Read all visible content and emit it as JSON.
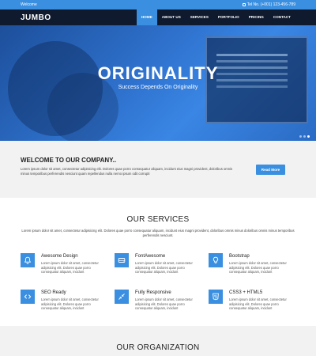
{
  "topbar": {
    "welcome": "Welcome",
    "phone": "Tel No. (+001) 123-456-789"
  },
  "logo": "JUMBO",
  "nav": [
    "HOME",
    "ABOUT US",
    "SERVICES",
    "PORTFOLIO",
    "PRICING",
    "CONTACT"
  ],
  "nav_active": "HOME",
  "hero": {
    "title": "ORIGINALITY",
    "subtitle": "Success Depends On Originality",
    "slide_count": 3,
    "active_slide": 3
  },
  "welcome": {
    "title": "WELCOME TO OUR COMPANY..",
    "text": "Lorem ipsum dolor sit amet, consectetur adipisicing elit. Dolores quae porro consequatur aliquam, incidunt eius magni provident, doloribus omnis minus temporibus perferendis nesciunt quam repellendus nulla nemo ipsum odit corrupti",
    "button": "Read More"
  },
  "services": {
    "title": "OUR SERVICES",
    "desc": "Lorem ipsum dolor sit amet, consectetur adipisicing elit. Dolores quae porro consequatur aliquam, incidunt eius magni provident, doloribus omnis minus doloribus omnis minus temporibus perferendis nesciunt.",
    "items": [
      {
        "title": "Awesome Design",
        "text": "Lorem ipsum dolor sit amet, consectetur adipisicing elit. Dolores quae porro consequatur aliquam, incidunt",
        "icon": "bell-icon"
      },
      {
        "title": "FontAwesome",
        "text": "Lorem ipsum dolor sit amet, consectetur adipisicing elit. Dolores quae porro consequatur aliquam, incidunt",
        "icon": "drive-icon"
      },
      {
        "title": "Bootstrap",
        "text": "Lorem ipsum dolor sit amet, consectetur adipisicing elit. Dolores quae porro consequatur aliquam, incidunt",
        "icon": "lightbulb-icon"
      },
      {
        "title": "SEO Ready",
        "text": "Lorem ipsum dolor sit amet, consectetur adipisicing elit. Dolores quae porro consequatur aliquam, incidunt",
        "icon": "code-icon"
      },
      {
        "title": "Fully Responsive",
        "text": "Lorem ipsum dolor sit amet, consectetur adipisicing elit. Dolores quae porro consequatur aliquam, incidunt",
        "icon": "compress-icon"
      },
      {
        "title": "CSS3 + HTML5",
        "text": "Lorem ipsum dolor sit amet, consectetur adipisicing elit. Dolores quae porro consequatur aliquam, incidunt",
        "icon": "html5-icon"
      }
    ]
  },
  "organization": {
    "title": "OUR ORGANIZATION"
  },
  "colors": {
    "accent": "#3a8fe0",
    "nav_bg": "#0f1a2e",
    "section_bg": "#f2f2f2"
  }
}
